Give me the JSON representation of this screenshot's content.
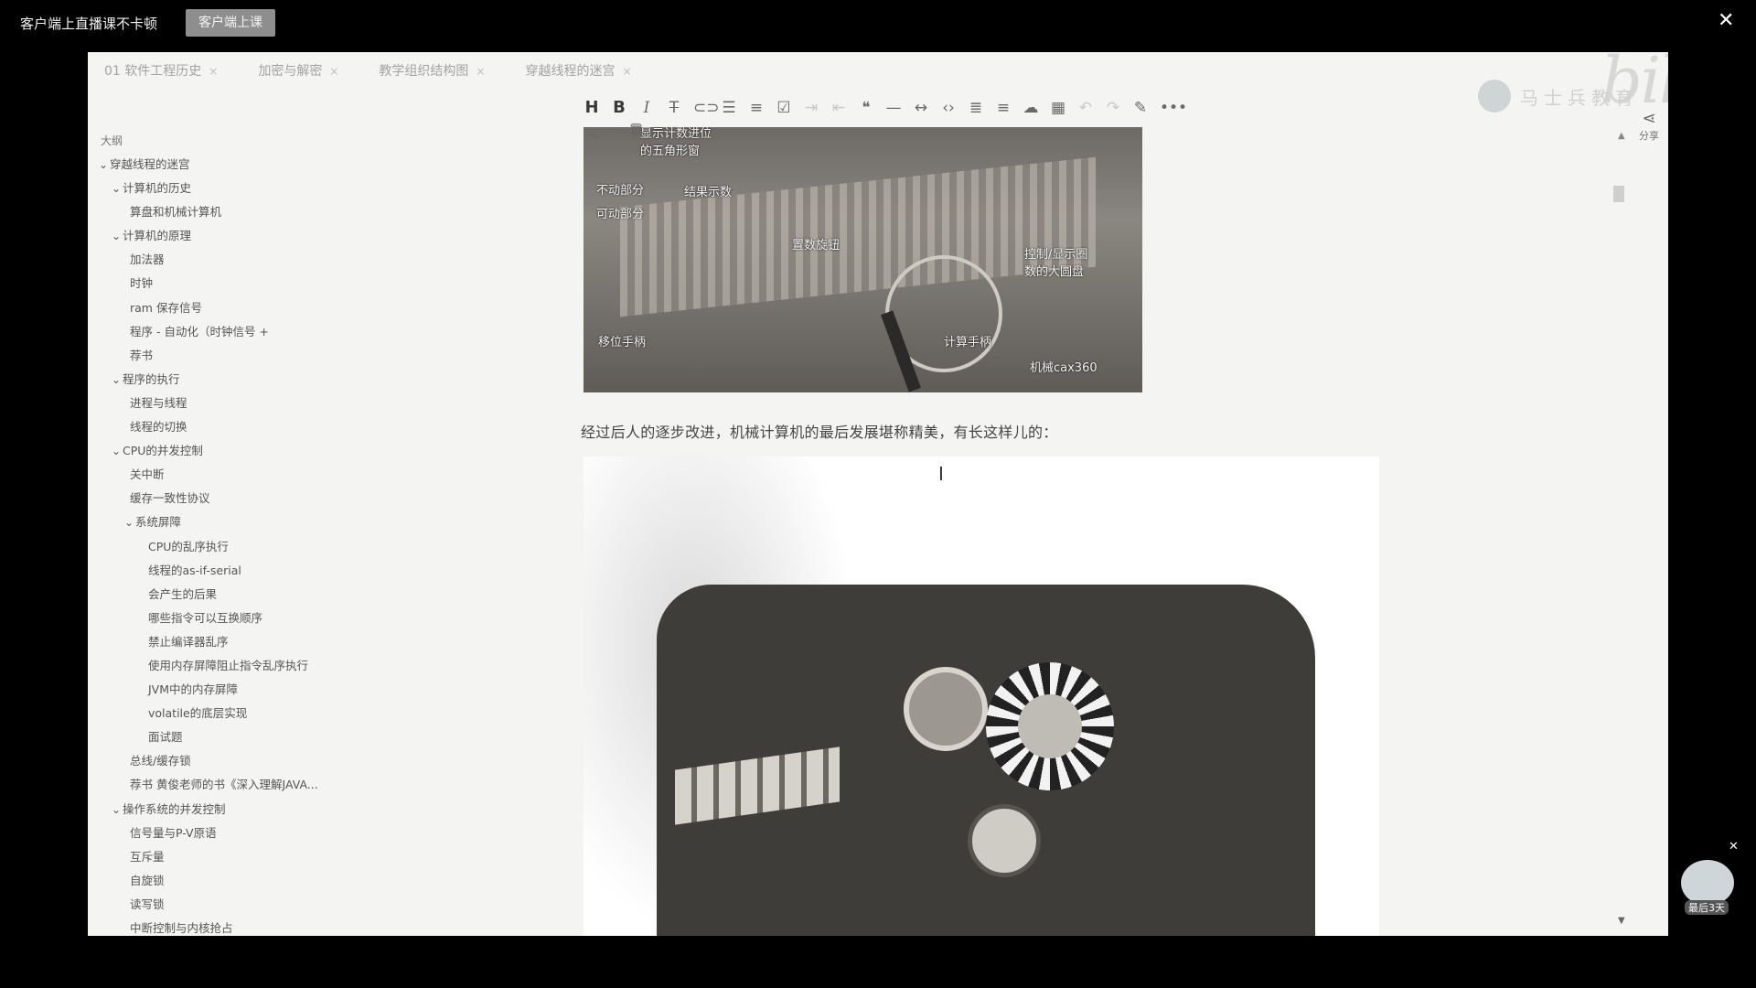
{
  "promo": {
    "text": "客户端上直播课不卡顿",
    "button": "客户端上课"
  },
  "window": {
    "close": "✕"
  },
  "tabs": [
    {
      "label": "01 软件工程历史"
    },
    {
      "label": "加密与解密"
    },
    {
      "label": "教学组织结构图"
    },
    {
      "label": "穿越线程的迷宫"
    }
  ],
  "tab_close": "×",
  "brand": {
    "bilibili": "bilibili",
    "watermark": "马士兵教育"
  },
  "sidebar": {
    "title": "大纲",
    "items": [
      {
        "label": "穿越线程的迷宫",
        "level": 1,
        "expanded": true
      },
      {
        "label": "计算机的历史",
        "level": 2,
        "expanded": true
      },
      {
        "label": "算盘和机械计算机",
        "level": 3
      },
      {
        "label": "计算机的原理",
        "level": 2,
        "expanded": true
      },
      {
        "label": "加法器",
        "level": 3
      },
      {
        "label": "时钟",
        "level": 3
      },
      {
        "label": "ram 保存信号",
        "level": 3
      },
      {
        "label": "程序 - 自动化（时钟信号 +",
        "level": 3
      },
      {
        "label": "荐书",
        "level": 3
      },
      {
        "label": "程序的执行",
        "level": 2,
        "expanded": true
      },
      {
        "label": "进程与线程",
        "level": 3
      },
      {
        "label": "线程的切换",
        "level": 3
      },
      {
        "label": "CPU的并发控制",
        "level": 2,
        "expanded": true
      },
      {
        "label": "关中断",
        "level": 3
      },
      {
        "label": "缓存一致性协议",
        "level": 3
      },
      {
        "label": "系统屏障",
        "level": 3,
        "expanded": true
      },
      {
        "label": "CPU的乱序执行",
        "level": 4
      },
      {
        "label": "线程的as-if-serial",
        "level": 4
      },
      {
        "label": "会产生的后果",
        "level": 4
      },
      {
        "label": "哪些指令可以互换顺序",
        "level": 4
      },
      {
        "label": "禁止编译器乱序",
        "level": 4
      },
      {
        "label": "使用内存屏障阻止指令乱序执行",
        "level": 4
      },
      {
        "label": "JVM中的内存屏障",
        "level": 4
      },
      {
        "label": "volatile的底层实现",
        "level": 4
      },
      {
        "label": "面试题",
        "level": 4
      },
      {
        "label": "总线/缓存锁",
        "level": 3
      },
      {
        "label": "荐书 黄俊老师的书《深入理解JAVA...",
        "level": 3
      },
      {
        "label": "操作系统的并发控制",
        "level": 2,
        "expanded": true
      },
      {
        "label": "信号量与P-V原语",
        "level": 3
      },
      {
        "label": "互斥量",
        "level": 3
      },
      {
        "label": "自旋锁",
        "level": 3
      },
      {
        "label": "读写锁",
        "level": 3
      },
      {
        "label": "中断控制与内核抢占",
        "level": 3
      }
    ]
  },
  "toolbar": {
    "icons": [
      "heading-icon",
      "bold-icon",
      "italic-icon",
      "strikethrough-icon",
      "link-icon",
      "bullet-list-icon",
      "ordered-list-icon",
      "checkbox-icon",
      "indent-icon",
      "outdent-icon",
      "quote-icon",
      "horizontal-rule-icon",
      "code-icon",
      "code-block-icon",
      "align-icon",
      "more-format-icon",
      "upload-icon",
      "table-icon",
      "undo-icon",
      "redo-icon",
      "pen-icon",
      "more-icon"
    ]
  },
  "image1": {
    "labels": {
      "top": "显示计数进位\n的五角形窗",
      "fixed": "不动部分",
      "movable": "可动部分",
      "result": "结果示数",
      "rotor": "置数旋钮",
      "display": "控制/显示圈\n数的大圆盘",
      "shift": "移位手柄",
      "crank": "计算手柄",
      "watermark": "机械cax360"
    }
  },
  "paragraph": "经过后人的逐步改进，机械计算机的最后发展堪称精美，有长这样儿的：",
  "share": {
    "label": "分享"
  },
  "badge": {
    "text": "最后3天"
  },
  "colors": {
    "frame_bg": "#f4f4f2",
    "top_bar": "#000000",
    "promo_button": "#8e8e8e"
  }
}
